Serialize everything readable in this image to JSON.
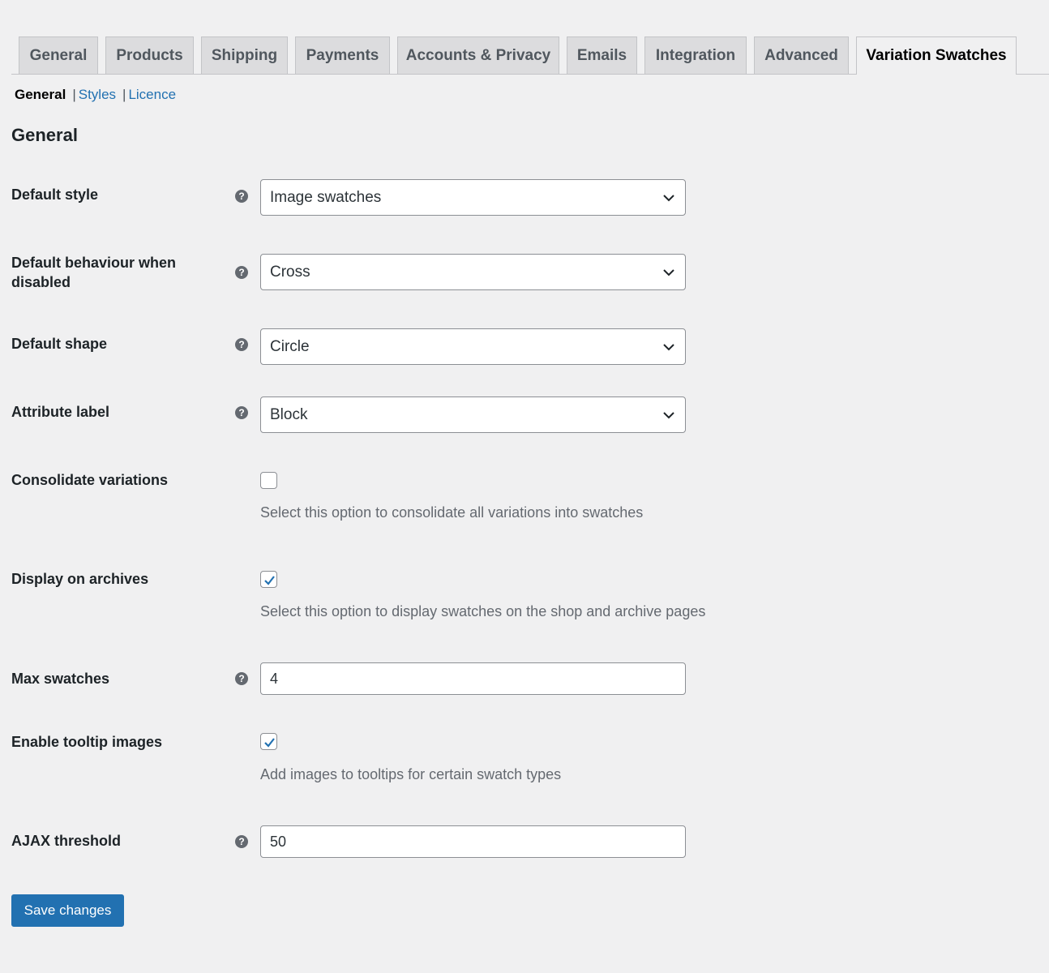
{
  "tabs": [
    {
      "label": "General",
      "active": false
    },
    {
      "label": "Products",
      "active": false
    },
    {
      "label": "Shipping",
      "active": false
    },
    {
      "label": "Payments",
      "active": false
    },
    {
      "label": "Accounts & Privacy",
      "active": false
    },
    {
      "label": "Emails",
      "active": false
    },
    {
      "label": "Integration",
      "active": false
    },
    {
      "label": "Advanced",
      "active": false
    },
    {
      "label": "Variation Swatches",
      "active": true
    }
  ],
  "subnav": {
    "current": "General",
    "sep": "|",
    "links": [
      "Styles",
      "Licence"
    ]
  },
  "section_title": "General",
  "fields": {
    "default_style": {
      "label": "Default style",
      "value": "Image swatches"
    },
    "default_behaviour": {
      "label_line1": "Default behaviour when",
      "label_line2": "disabled",
      "value": "Cross"
    },
    "default_shape": {
      "label": "Default shape",
      "value": "Circle"
    },
    "attribute_label": {
      "label": "Attribute label",
      "value": "Block"
    },
    "consolidate": {
      "label": "Consolidate variations",
      "checked": false,
      "description": "Select this option to consolidate all variations into swatches"
    },
    "display_archives": {
      "label": "Display on archives",
      "checked": true,
      "description": "Select this option to display swatches on the shop and archive pages"
    },
    "max_swatches": {
      "label": "Max swatches",
      "value": "4"
    },
    "tooltip_images": {
      "label": "Enable tooltip images",
      "checked": true,
      "description": "Add images to tooltips for certain swatch types"
    },
    "ajax_threshold": {
      "label": "AJAX threshold",
      "value": "50"
    }
  },
  "help_glyph": "?",
  "save_label": "Save changes",
  "colors": {
    "accent": "#2271b1",
    "background": "#f0f0f1",
    "tab_inactive": "#dcdcde"
  }
}
